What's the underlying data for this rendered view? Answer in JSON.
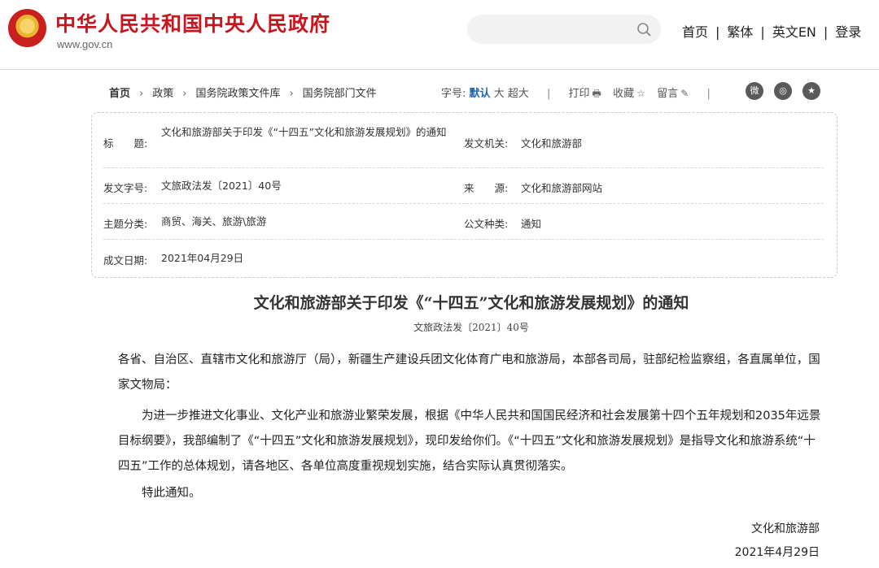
{
  "header": {
    "site_title": "中华人民共和国中央人民政府",
    "site_url": "www.gov.cn",
    "search_placeholder": "",
    "nav": [
      "首页",
      "繁体",
      "英文EN",
      "登录"
    ],
    "nav_separator": "|"
  },
  "breadcrumb": {
    "items": [
      "首页",
      "政策",
      "国务院政策文件库",
      "国务院部门文件"
    ],
    "arrow": "›"
  },
  "tools": {
    "font_size_label": "字号:",
    "font_sizes": [
      "默认",
      "大",
      "超大"
    ],
    "print": "打印",
    "favorite": "收藏",
    "comment": "留言",
    "separator": "|"
  },
  "share_icons": [
    "weibo-icon",
    "wechat-icon",
    "qzone-icon"
  ],
  "info": {
    "title_label": "标　　题:",
    "title_value": "文化和旅游部关于印发《“十四五”文化和旅游发展规划》的通知",
    "issuer_label": "发文机关:",
    "issuer_value": "文化和旅游部",
    "docno_label": "发文字号:",
    "docno_value": "文旅政法发〔2021〕40号",
    "source_label": "来　　源:",
    "source_value": "文化和旅游部网站",
    "topic_label": "主题分类:",
    "topic_value": "商贸、海关、旅游\\旅游",
    "type_label": "公文种类:",
    "type_value": "通知",
    "date_label": "成文日期:",
    "date_value": "2021年04月29日"
  },
  "article": {
    "title": "文化和旅游部关于印发《“十四五”文化和旅游发展规划》的通知",
    "doc_number": "文旅政法发〔2021〕40号",
    "salutation": "各省、自治区、直辖市文化和旅游厅（局），新疆生产建设兵团文化体育广电和旅游局，本部各司局，驻部纪检监察组，各直属单位，国家文物局：",
    "body": "为进一步推进文化事业、文化产业和旅游业繁荣发展，根据《中华人民共和国国民经济和社会发展第十四个五年规划和2035年远景目标纲要》，我部编制了《“十四五”文化和旅游发展规划》，现印发给你们。《“十四五”文化和旅游发展规划》是指导文化和旅游系统“十四五”工作的总体规划，请各地区、各单位高度重视规划实施，结合实际认真贯彻落实。",
    "closing": "特此通知。",
    "signature": "文化和旅游部",
    "date": "2021年4月29日"
  }
}
